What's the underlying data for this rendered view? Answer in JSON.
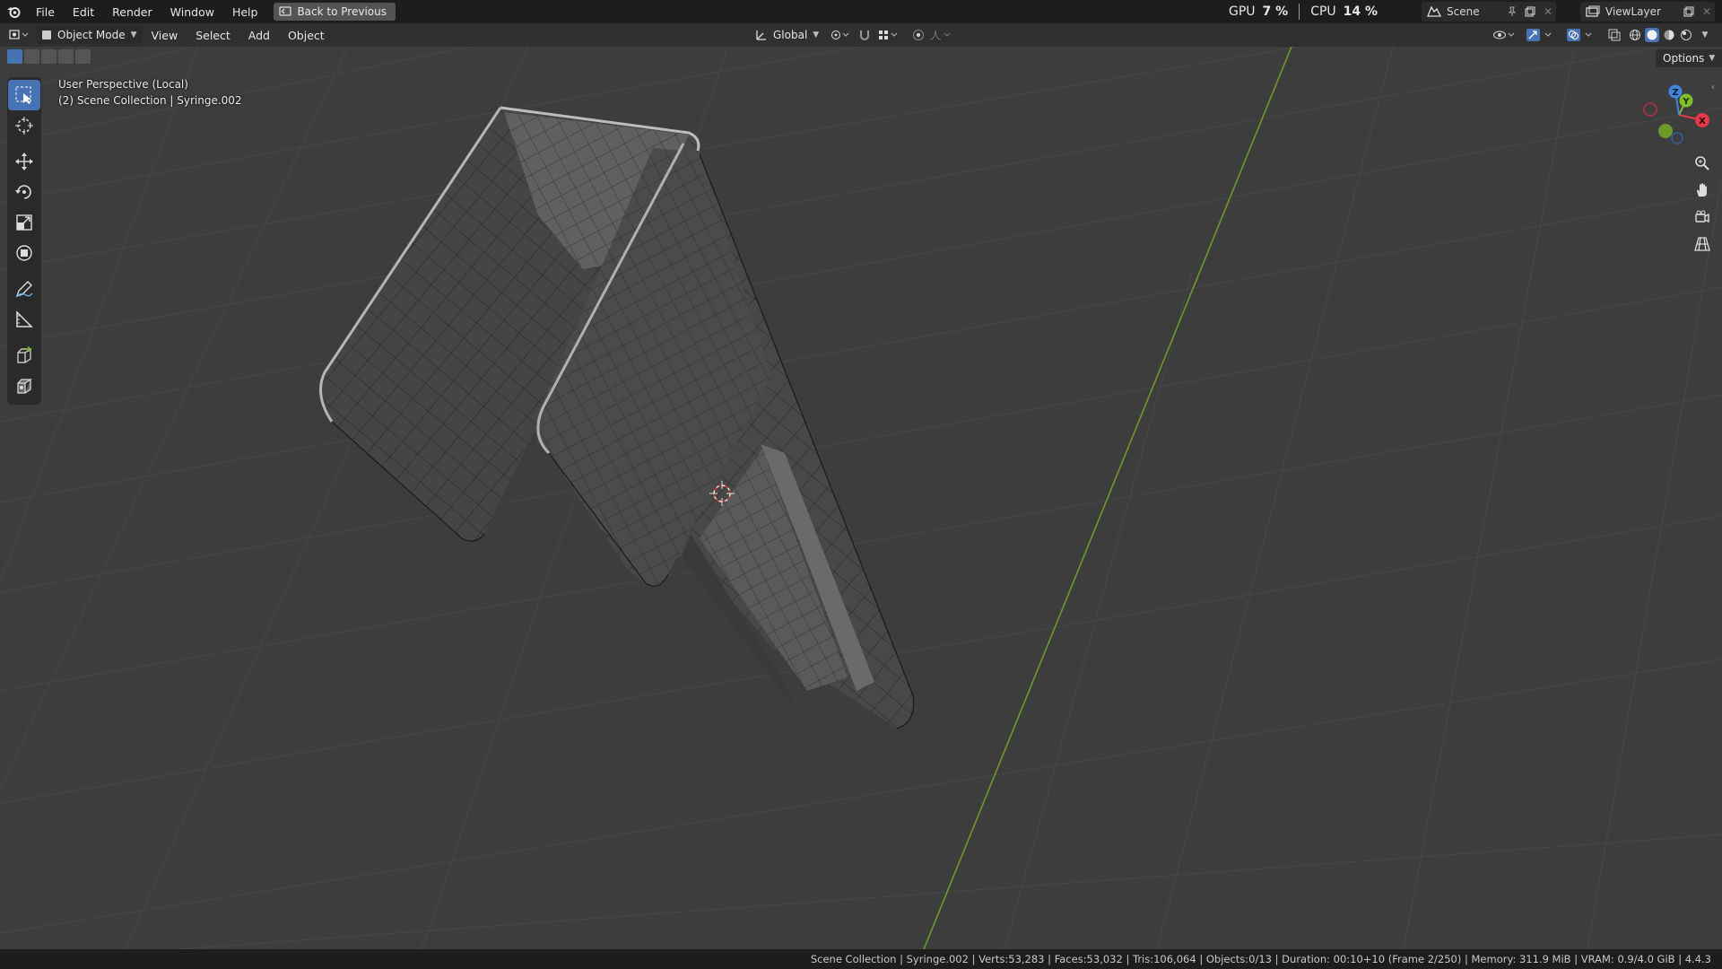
{
  "menu": {
    "file": "File",
    "edit": "Edit",
    "render": "Render",
    "window": "Window",
    "help": "Help"
  },
  "back_button": "Back to Previous",
  "stats": {
    "gpu_label": "GPU",
    "gpu_value": "7 %",
    "cpu_label": "CPU",
    "cpu_value": "14 %"
  },
  "scene": {
    "name": "Scene"
  },
  "view_layer": {
    "name": "ViewLayer"
  },
  "header": {
    "mode": "Object Mode",
    "view": "View",
    "select": "Select",
    "add": "Add",
    "object": "Object",
    "orientation": "Global"
  },
  "viewport": {
    "perspective": "User Perspective (Local)",
    "collection_info": "(2) Scene Collection | Syringe.002",
    "options": "Options"
  },
  "gizmo": {
    "x": "X",
    "y": "Y",
    "z": "Z"
  },
  "status_bar": "Scene Collection | Syringe.002 | Verts:53,283 | Faces:53,032 | Tris:106,064 | Objects:0/13 | Duration: 00:10+10 (Frame 2/250) | Memory: 311.9 MiB | VRAM: 0.9/4.0 GiB | 4.4.3",
  "colors": {
    "accent": "#4772b3",
    "axis_y_line": "#6c9a2a",
    "gizmo_x": "#e5384a",
    "gizmo_y": "#7fbf2a",
    "gizmo_z": "#3f86e0"
  }
}
